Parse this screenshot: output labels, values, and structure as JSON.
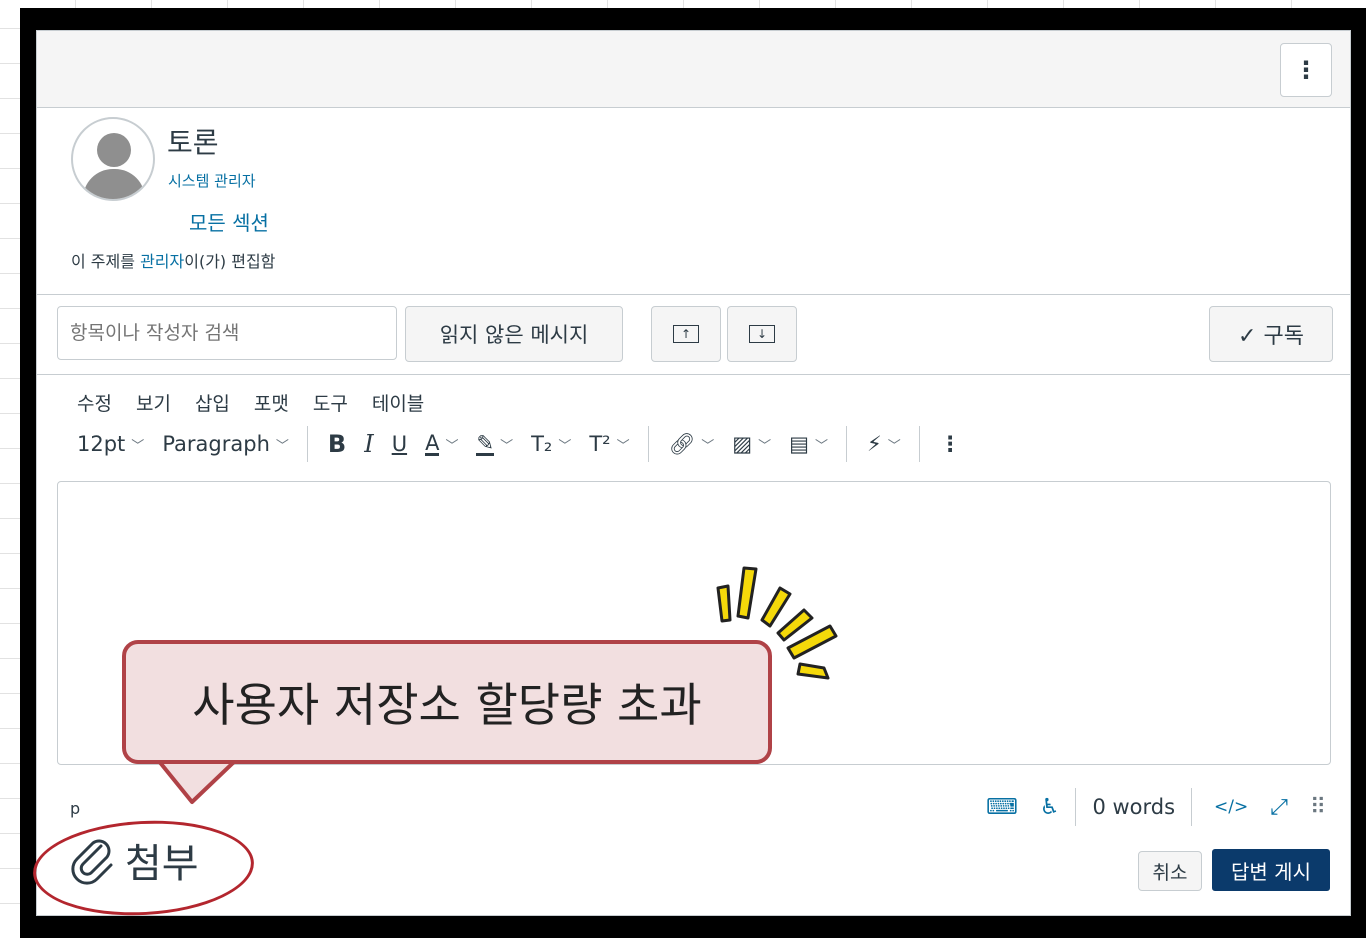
{
  "header": {
    "more_label": "⋮"
  },
  "post": {
    "author": "토론",
    "role": "시스템 관리자",
    "sections": "모든 섹션",
    "edited_prefix": "이 주제를 ",
    "edited_link": "관리자",
    "edited_suffix": "이(가) 편집함"
  },
  "toolbar": {
    "search_placeholder": "항목이나 작성자 검색",
    "unread_label": "읽지 않은 메시지",
    "subscribe_label": "✓ 구독"
  },
  "editor": {
    "menus": [
      "수정",
      "보기",
      "삽입",
      "포맷",
      "도구",
      "테이블"
    ],
    "font_size": "12pt",
    "block_format": "Paragraph",
    "path": "p",
    "word_count": "0 words"
  },
  "actions": {
    "attach_label": "첨부",
    "cancel_label": "취소",
    "post_label": "답변 게시"
  },
  "callout": {
    "text": "사용자 저장소 할당량 초과"
  },
  "colors": {
    "link": "#0770a3",
    "primary": "#0b3a6b",
    "highlight": "#b3262e",
    "burst": "#f5d90a"
  }
}
